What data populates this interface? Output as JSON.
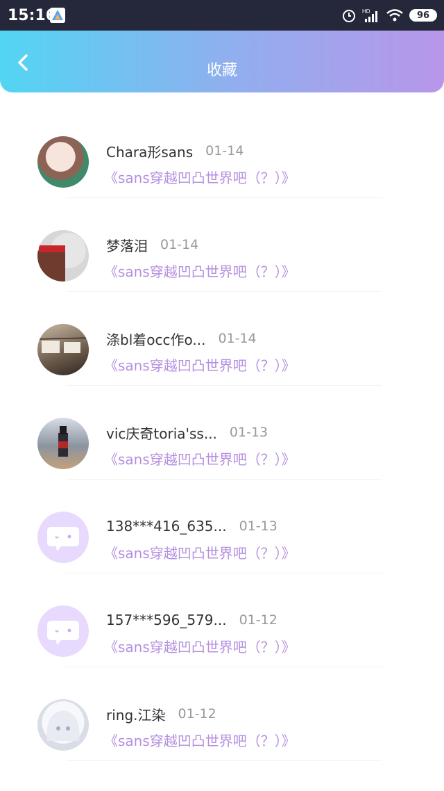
{
  "status_bar": {
    "time": "15:16",
    "battery": "96",
    "icons": [
      "app-icon",
      "alarm-icon",
      "hd-signal-icon",
      "wifi-icon",
      "battery-icon"
    ]
  },
  "header": {
    "title": "收藏",
    "back_icon": "chevron-left-icon",
    "gradient": [
      "#52d5f3",
      "#b896ea"
    ]
  },
  "colors": {
    "title_link": "#b48fe0",
    "name": "#333333",
    "date": "#999999"
  },
  "items": [
    {
      "name": "Chara形sans",
      "date": "01-14",
      "title": "《sans穿越凹凸世界吧（？）》",
      "avatar": "photo"
    },
    {
      "name": "梦落泪",
      "date": "01-14",
      "title": "《sans穿越凹凸世界吧（？）》",
      "avatar": "photo"
    },
    {
      "name": "涤bl着occ作o...",
      "date": "01-14",
      "title": "《sans穿越凹凸世界吧（？）》",
      "avatar": "photo"
    },
    {
      "name": "vic庆奇toria'ss...",
      "date": "01-13",
      "title": "《sans穿越凹凸世界吧（？）》",
      "avatar": "photo"
    },
    {
      "name": "138***416_635...",
      "date": "01-13",
      "title": "《sans穿越凹凸世界吧（？）》",
      "avatar": "default-chat-bubble"
    },
    {
      "name": "157***596_579...",
      "date": "01-12",
      "title": "《sans穿越凹凸世界吧（？）》",
      "avatar": "default-chat-bubble"
    },
    {
      "name": "ring.江染",
      "date": "01-12",
      "title": "《sans穿越凹凸世界吧（？）》",
      "avatar": "photo"
    }
  ]
}
